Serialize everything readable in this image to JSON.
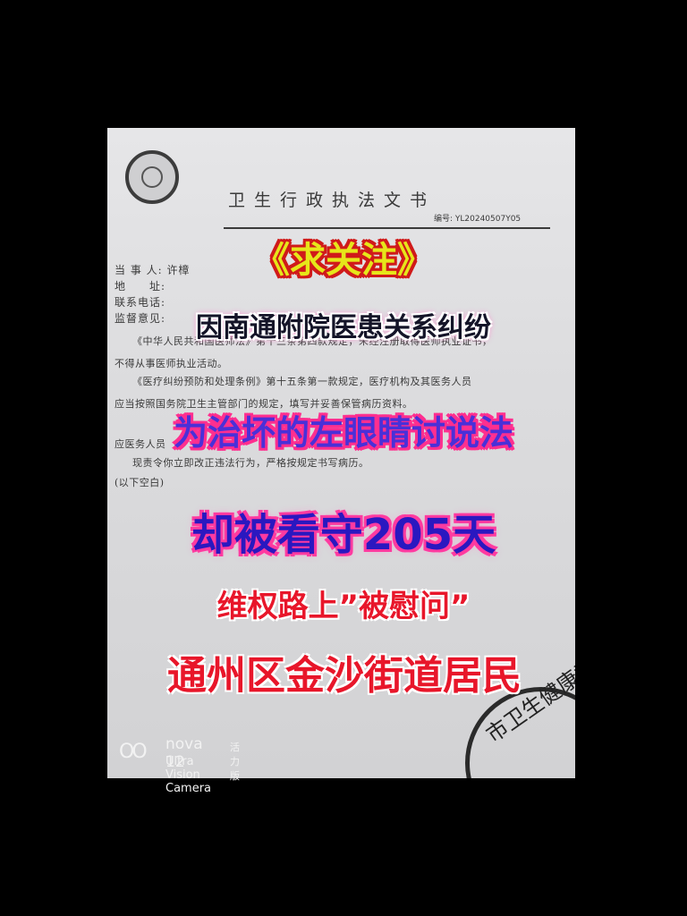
{
  "document": {
    "title": "卫生行政执法文书",
    "number": "编号: YL20240507Y05",
    "fields": [
      "当 事 人: 许樟",
      "地　　址:",
      "联系电话:",
      "监督意见:"
    ],
    "body_lines": [
      "《中华人民共和国医师法》第十三条第四款规定，未经注册取得医师执业证书，",
      "不得从事医师执业活动。",
      "《医疗纠纷预防和处理条例》第十五条第一款规定，医疗机构及其医务人员",
      "应当按照国务院卫生主管部门的规定，填写并妥善保管病历资料。",
      "应医务人员",
      "现责令你立即改正违法行为，严格按规定书写病历。",
      "(以下空白)"
    ],
    "stamp_text": "市卫生健康委"
  },
  "overlay": {
    "line1": "《求关注》",
    "line2": "因南通附院医患关系纠纷",
    "line3": "为治坏的左眼睛讨说法",
    "line4": "却被看守205天",
    "line5": "维权路上”被慰问”",
    "line6": "通州区金沙街道居民"
  },
  "watermark": {
    "logo": "OO",
    "model": "nova 12",
    "edition": "活力版",
    "camera": "Ultra Vision Camera"
  }
}
